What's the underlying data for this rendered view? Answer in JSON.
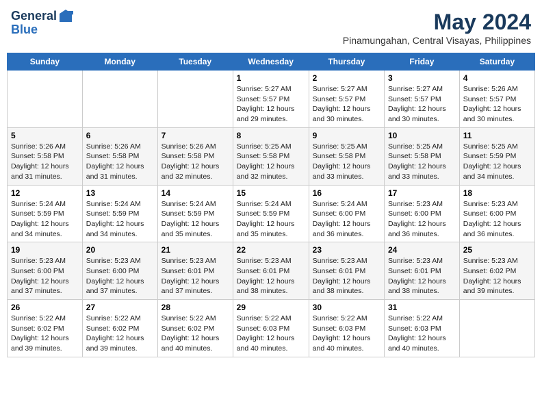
{
  "header": {
    "logo_line1": "General",
    "logo_line2": "Blue",
    "main_title": "May 2024",
    "subtitle": "Pinamungahan, Central Visayas, Philippines"
  },
  "weekdays": [
    "Sunday",
    "Monday",
    "Tuesday",
    "Wednesday",
    "Thursday",
    "Friday",
    "Saturday"
  ],
  "weeks": [
    [
      {
        "day": "",
        "detail": ""
      },
      {
        "day": "",
        "detail": ""
      },
      {
        "day": "",
        "detail": ""
      },
      {
        "day": "1",
        "detail": "Sunrise: 5:27 AM\nSunset: 5:57 PM\nDaylight: 12 hours\nand 29 minutes."
      },
      {
        "day": "2",
        "detail": "Sunrise: 5:27 AM\nSunset: 5:57 PM\nDaylight: 12 hours\nand 30 minutes."
      },
      {
        "day": "3",
        "detail": "Sunrise: 5:27 AM\nSunset: 5:57 PM\nDaylight: 12 hours\nand 30 minutes."
      },
      {
        "day": "4",
        "detail": "Sunrise: 5:26 AM\nSunset: 5:57 PM\nDaylight: 12 hours\nand 30 minutes."
      }
    ],
    [
      {
        "day": "5",
        "detail": "Sunrise: 5:26 AM\nSunset: 5:58 PM\nDaylight: 12 hours\nand 31 minutes."
      },
      {
        "day": "6",
        "detail": "Sunrise: 5:26 AM\nSunset: 5:58 PM\nDaylight: 12 hours\nand 31 minutes."
      },
      {
        "day": "7",
        "detail": "Sunrise: 5:26 AM\nSunset: 5:58 PM\nDaylight: 12 hours\nand 32 minutes."
      },
      {
        "day": "8",
        "detail": "Sunrise: 5:25 AM\nSunset: 5:58 PM\nDaylight: 12 hours\nand 32 minutes."
      },
      {
        "day": "9",
        "detail": "Sunrise: 5:25 AM\nSunset: 5:58 PM\nDaylight: 12 hours\nand 33 minutes."
      },
      {
        "day": "10",
        "detail": "Sunrise: 5:25 AM\nSunset: 5:58 PM\nDaylight: 12 hours\nand 33 minutes."
      },
      {
        "day": "11",
        "detail": "Sunrise: 5:25 AM\nSunset: 5:59 PM\nDaylight: 12 hours\nand 34 minutes."
      }
    ],
    [
      {
        "day": "12",
        "detail": "Sunrise: 5:24 AM\nSunset: 5:59 PM\nDaylight: 12 hours\nand 34 minutes."
      },
      {
        "day": "13",
        "detail": "Sunrise: 5:24 AM\nSunset: 5:59 PM\nDaylight: 12 hours\nand 34 minutes."
      },
      {
        "day": "14",
        "detail": "Sunrise: 5:24 AM\nSunset: 5:59 PM\nDaylight: 12 hours\nand 35 minutes."
      },
      {
        "day": "15",
        "detail": "Sunrise: 5:24 AM\nSunset: 5:59 PM\nDaylight: 12 hours\nand 35 minutes."
      },
      {
        "day": "16",
        "detail": "Sunrise: 5:24 AM\nSunset: 6:00 PM\nDaylight: 12 hours\nand 36 minutes."
      },
      {
        "day": "17",
        "detail": "Sunrise: 5:23 AM\nSunset: 6:00 PM\nDaylight: 12 hours\nand 36 minutes."
      },
      {
        "day": "18",
        "detail": "Sunrise: 5:23 AM\nSunset: 6:00 PM\nDaylight: 12 hours\nand 36 minutes."
      }
    ],
    [
      {
        "day": "19",
        "detail": "Sunrise: 5:23 AM\nSunset: 6:00 PM\nDaylight: 12 hours\nand 37 minutes."
      },
      {
        "day": "20",
        "detail": "Sunrise: 5:23 AM\nSunset: 6:00 PM\nDaylight: 12 hours\nand 37 minutes."
      },
      {
        "day": "21",
        "detail": "Sunrise: 5:23 AM\nSunset: 6:01 PM\nDaylight: 12 hours\nand 37 minutes."
      },
      {
        "day": "22",
        "detail": "Sunrise: 5:23 AM\nSunset: 6:01 PM\nDaylight: 12 hours\nand 38 minutes."
      },
      {
        "day": "23",
        "detail": "Sunrise: 5:23 AM\nSunset: 6:01 PM\nDaylight: 12 hours\nand 38 minutes."
      },
      {
        "day": "24",
        "detail": "Sunrise: 5:23 AM\nSunset: 6:01 PM\nDaylight: 12 hours\nand 38 minutes."
      },
      {
        "day": "25",
        "detail": "Sunrise: 5:23 AM\nSunset: 6:02 PM\nDaylight: 12 hours\nand 39 minutes."
      }
    ],
    [
      {
        "day": "26",
        "detail": "Sunrise: 5:22 AM\nSunset: 6:02 PM\nDaylight: 12 hours\nand 39 minutes."
      },
      {
        "day": "27",
        "detail": "Sunrise: 5:22 AM\nSunset: 6:02 PM\nDaylight: 12 hours\nand 39 minutes."
      },
      {
        "day": "28",
        "detail": "Sunrise: 5:22 AM\nSunset: 6:02 PM\nDaylight: 12 hours\nand 40 minutes."
      },
      {
        "day": "29",
        "detail": "Sunrise: 5:22 AM\nSunset: 6:03 PM\nDaylight: 12 hours\nand 40 minutes."
      },
      {
        "day": "30",
        "detail": "Sunrise: 5:22 AM\nSunset: 6:03 PM\nDaylight: 12 hours\nand 40 minutes."
      },
      {
        "day": "31",
        "detail": "Sunrise: 5:22 AM\nSunset: 6:03 PM\nDaylight: 12 hours\nand 40 minutes."
      },
      {
        "day": "",
        "detail": ""
      }
    ]
  ]
}
